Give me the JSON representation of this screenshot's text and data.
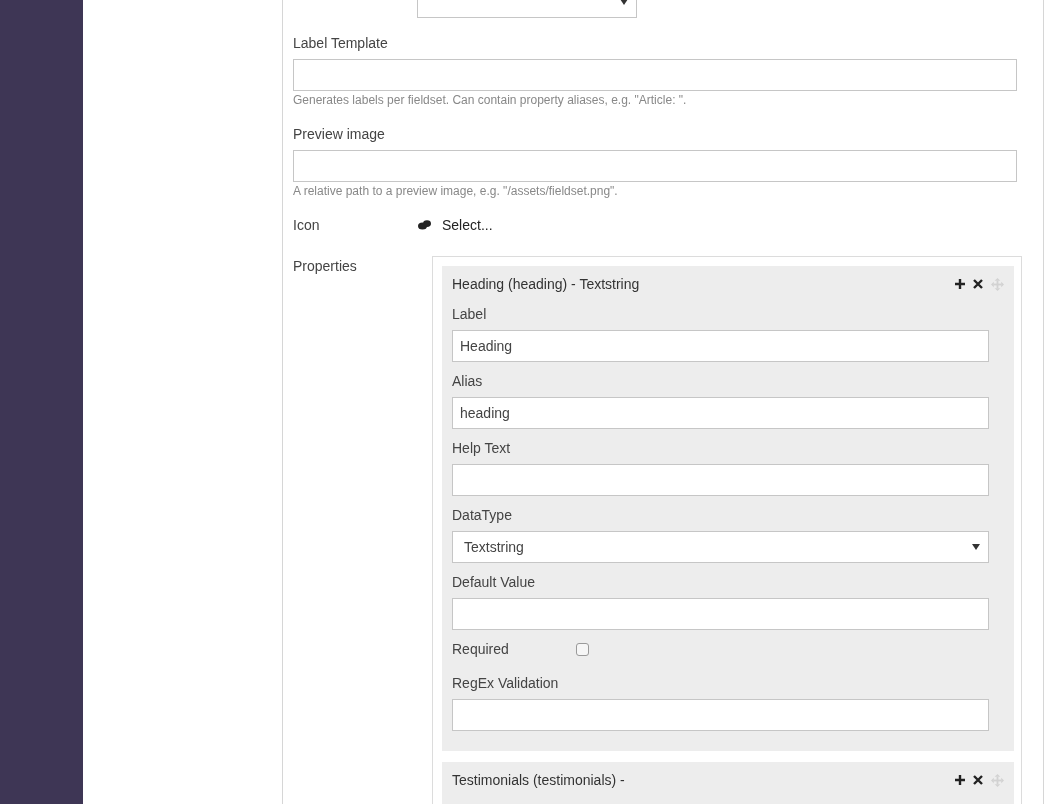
{
  "fields": [
    {
      "kind": "select"
    },
    {
      "kind": "text",
      "label": "Label Template",
      "help": "Generates labels per fieldset. Can contain property aliases, e.g. \"Article: \"."
    },
    {
      "kind": "text",
      "label": "Preview image",
      "help": "A relative path to a preview image, e.g. \"/assets/fieldset.png\"."
    },
    {
      "kind": "icon",
      "label": "Icon",
      "link": "Select..."
    },
    {
      "kind": "properties",
      "label": "Properties",
      "items": [
        {
          "title": "Heading (heading) - Textstring",
          "fields": [
            {
              "kind": "text",
              "label": "Label",
              "value": "Heading"
            },
            {
              "kind": "text",
              "label": "Alias",
              "value": "heading"
            },
            {
              "kind": "text",
              "label": "Help Text"
            },
            {
              "kind": "select",
              "label": "DataType",
              "value": "Textstring"
            },
            {
              "kind": "text",
              "label": "Default Value"
            },
            {
              "kind": "checkbox",
              "label": "Required",
              "checked": false
            },
            {
              "kind": "text",
              "label": "RegEx Validation"
            }
          ]
        },
        {
          "title": "Testimonials (testimonials) -"
        }
      ]
    }
  ]
}
